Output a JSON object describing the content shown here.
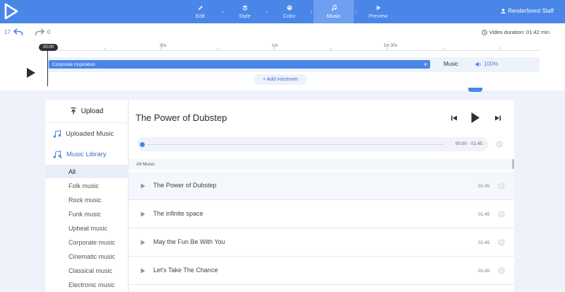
{
  "nav": {
    "steps": [
      {
        "label": "Edit",
        "icon": "pencil-icon"
      },
      {
        "label": "Style",
        "icon": "layers-icon"
      },
      {
        "label": "Color",
        "icon": "palette-icon"
      },
      {
        "label": "Music",
        "icon": "music-note-icon",
        "active": true
      },
      {
        "label": "Preview",
        "icon": "play-icon"
      }
    ],
    "user": "Renderforest Staff"
  },
  "editor": {
    "undo_count": "17",
    "redo_count": "0",
    "duration": "Video duration: 01:42 min",
    "ruler": [
      "30s",
      "1m",
      "1m 30s"
    ],
    "playhead": "00:00",
    "clip_name": "Corporate Inspiration",
    "track_type": "Music",
    "volume": "100%",
    "add_voiceover": "+ Add voiceover"
  },
  "sidebar": {
    "upload": "Upload",
    "uploaded_music": "Uploaded Music",
    "music_library": "Music Library",
    "genres": [
      "All",
      "Folk music",
      "Rock music",
      "Funk music",
      "Upbeat music",
      "Corporate music",
      "Cinematic music",
      "Classical music",
      "Electronic music"
    ],
    "selected_genre": "All"
  },
  "player": {
    "title": "The Power of Dubstep",
    "time": "00:00 - 01:45"
  },
  "list": {
    "header": "All Music",
    "tracks": [
      {
        "name": "The Power of Dubstep",
        "duration": "01:45"
      },
      {
        "name": "The infinite space",
        "duration": "01:45"
      },
      {
        "name": "May the Fun Be With You",
        "duration": "01:45"
      },
      {
        "name": "Let's Take The Chance",
        "duration": "01:45"
      }
    ]
  },
  "colors": {
    "accent": "#4a86e8",
    "nav_active": "#6f9ff0",
    "dark": "#2b2f3a"
  }
}
